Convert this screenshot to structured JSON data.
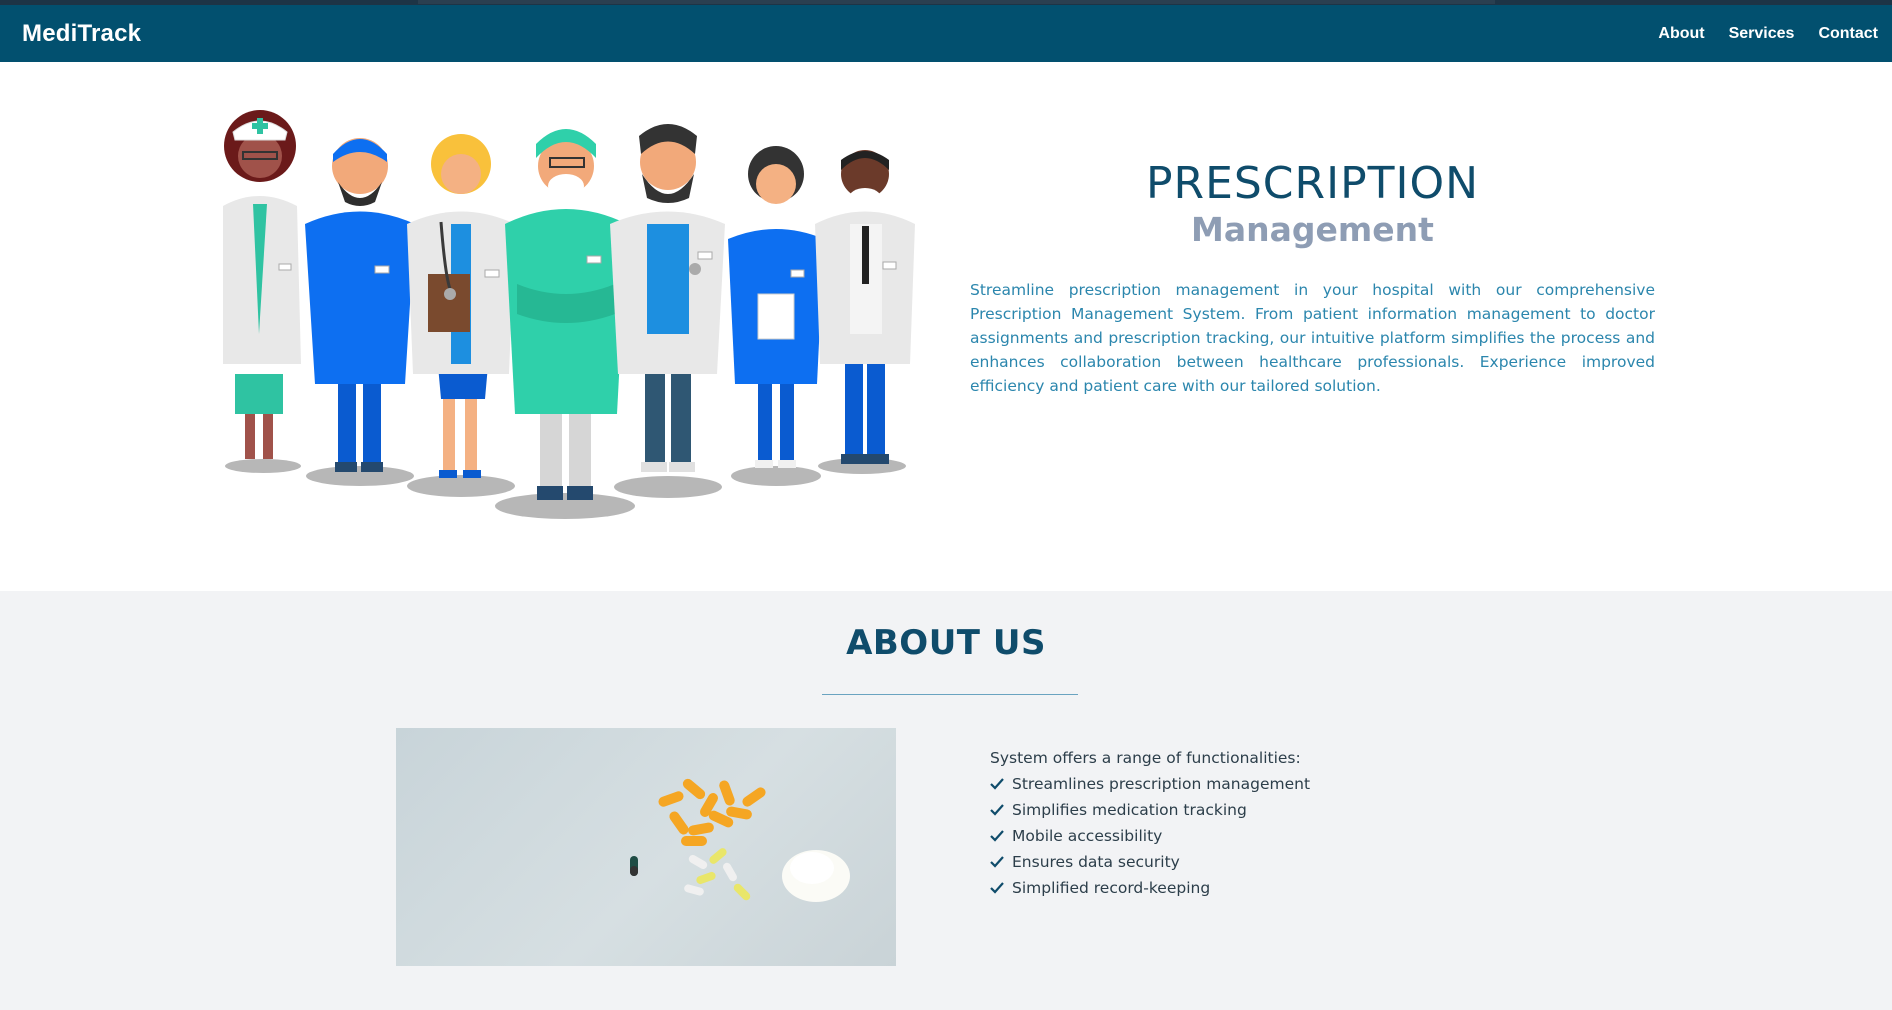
{
  "nav": {
    "brand": "MediTrack",
    "links": [
      "About",
      "Services",
      "Contact"
    ]
  },
  "hero": {
    "title": "PRESCRIPTION",
    "subtitle": "Management",
    "description": "Streamline prescription management in your hospital with our comprehensive Prescription Management System. From patient information management to doctor assignments and prescription tracking, our intuitive platform simplifies the process and enhances collaboration between healthcare professionals. Experience improved efficiency and patient care with our tailored solution."
  },
  "about": {
    "title": "ABOUT US",
    "intro": "System offers a range of functionalities:",
    "features": [
      "Streamlines prescription management",
      "Simplifies medication tracking",
      "Mobile accessibility",
      "Ensures data security",
      "Simplified record-keeping"
    ]
  },
  "colors": {
    "navbar": "#02506f",
    "title": "#0f4c6b",
    "subtitle": "#8e9db4",
    "body_text": "#2b86ad",
    "about_bg": "#f2f3f5"
  },
  "icons": {
    "feature_bullet": "check-icon"
  }
}
